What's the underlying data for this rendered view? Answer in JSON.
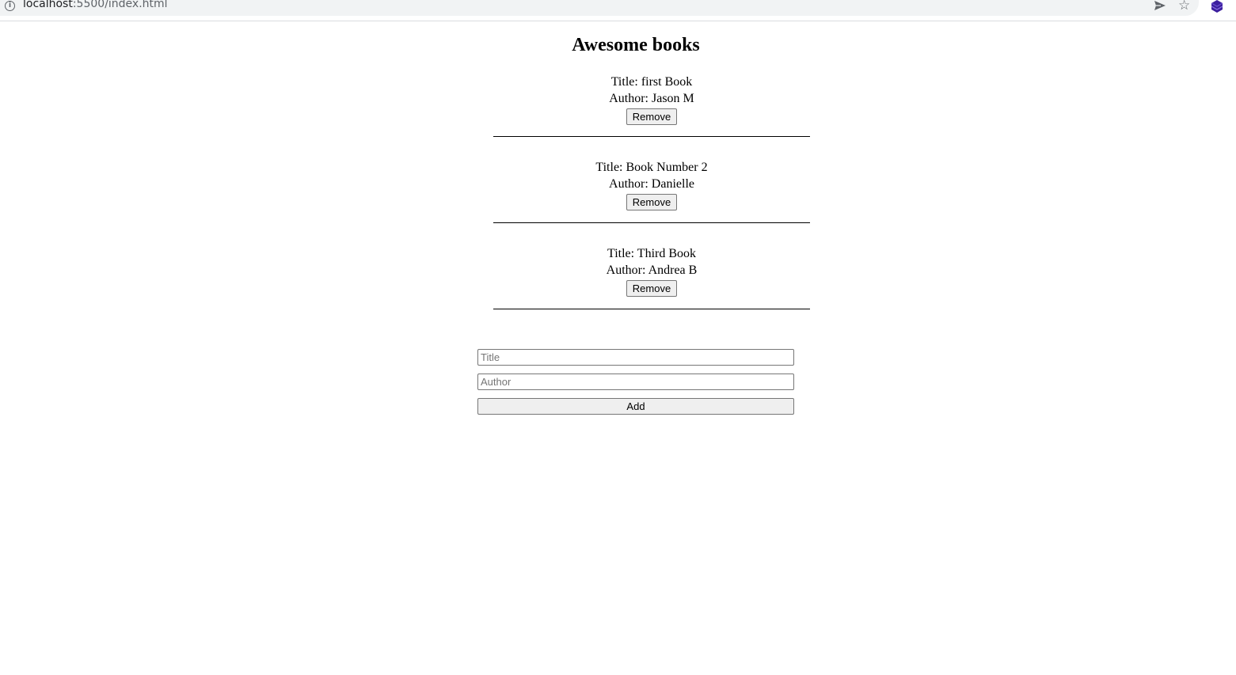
{
  "browser": {
    "url_host": "localhost",
    "url_path": ":5500/index.html",
    "icons": [
      "info-icon",
      "send-icon",
      "star-icon",
      "extension-icon"
    ]
  },
  "page": {
    "title": "Awesome books"
  },
  "books": [
    {
      "title_text": "Title: first Book",
      "author_text": "Author: Jason M",
      "remove_label": "Remove"
    },
    {
      "title_text": "Title: Book Number 2",
      "author_text": "Author: Danielle",
      "remove_label": "Remove"
    },
    {
      "title_text": "Title: Third Book",
      "author_text": "Author: Andrea B",
      "remove_label": "Remove"
    }
  ],
  "form": {
    "title_placeholder": "Title",
    "author_placeholder": "Author",
    "title_value": "",
    "author_value": "",
    "add_label": "Add"
  },
  "colors": {
    "extension_icon": "#3c1f9e",
    "address_bar_bg": "#f1f3f4"
  }
}
